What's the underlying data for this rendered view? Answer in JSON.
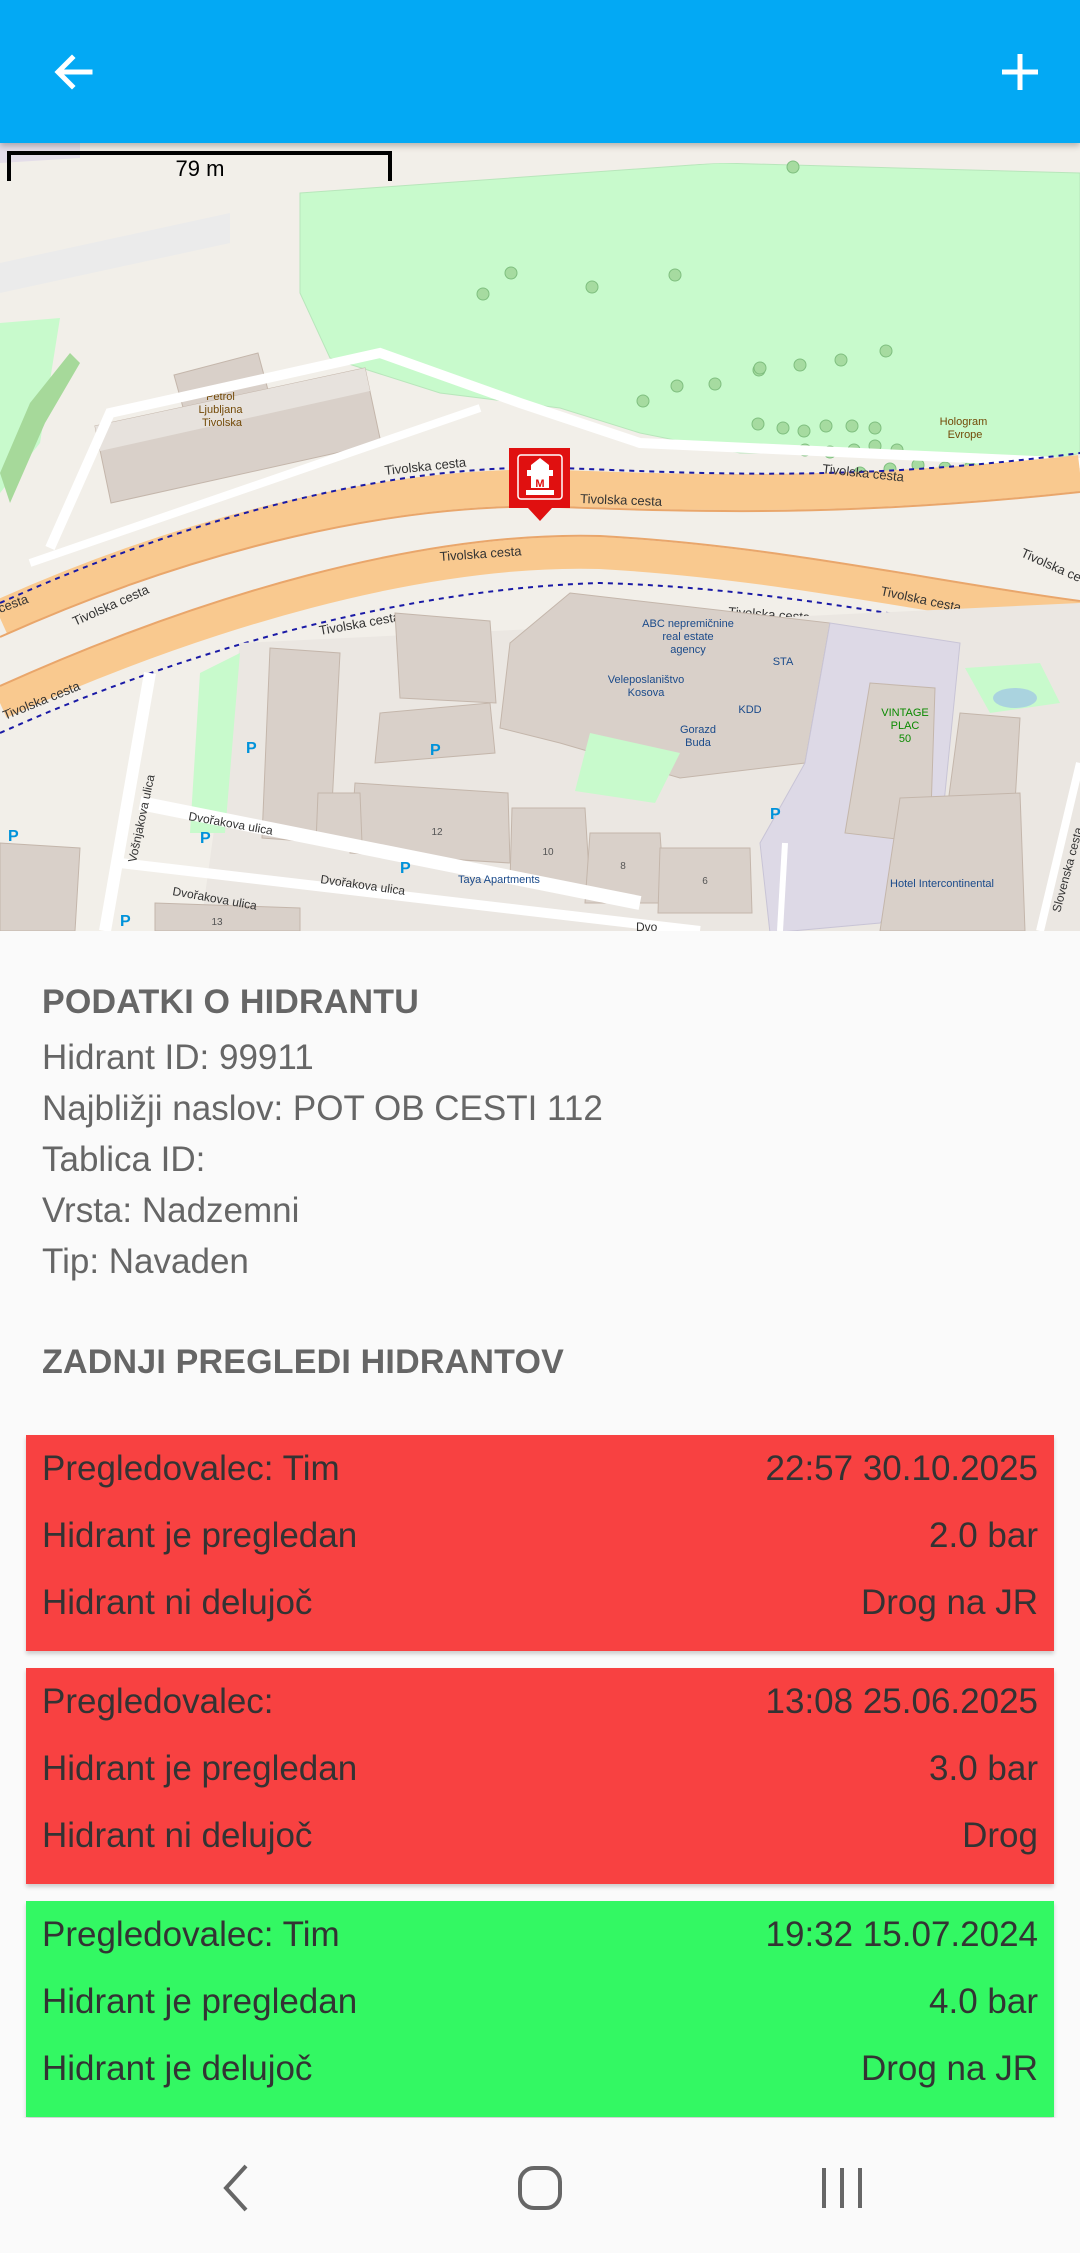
{
  "appbar": {
    "back_icon": "arrow-left-icon",
    "add_icon": "plus-icon",
    "background": "#03a9f4"
  },
  "map": {
    "scale_label": "79 m",
    "marker_icon": "hydrant-marker-icon",
    "labels": {
      "tivolska_1": "Tivolska cesta",
      "tivolska_2": "Tivolska cesta",
      "tivolska_3": "Tivolska cesta",
      "tivolska_4": "Tivolska cesta",
      "tivolska_5": "Tivolska cesta",
      "tivolska_6": "Tivolska cesta",
      "tivolska_7": "Tivolska cesta",
      "tivolska_8": "Tivolska cesta",
      "tivolska_9": "Tivolska cesta",
      "tivolska_10": "Tivolska cesta",
      "cesta_edge": "cesta",
      "petrol_1": "Petrol",
      "petrol_2": "Ljubljana",
      "petrol_3": "Tivolska",
      "hologram_1": "Hologram",
      "hologram_2": "Evrope",
      "abc_1": "ABC nepremičnine",
      "abc_2": "real estate",
      "abc_3": "agency",
      "sta": "STA",
      "kdd": "KDD",
      "veleposlanistvo_1": "Veleposlaništvo",
      "veleposlanistvo_2": "Kosova",
      "gorazd_1": "Gorazd",
      "gorazd_2": "Buda",
      "vintage_1": "VINTAGE",
      "vintage_2": "PLAC",
      "vintage_3": "50",
      "dvorakova_1": "Dvořakova ulica",
      "dvorakova_2": "Dvořakova ulica",
      "dvorakova_3": "Dvořakova ulica",
      "vosnjakova": "Vošnjakova ulica",
      "taya": "Taya Apartments",
      "hotel": "Hotel Intercontinental",
      "slovenska": "Slovenska cesta",
      "n12": "12",
      "n10": "10",
      "n8": "8",
      "n6": "6",
      "n13": "13",
      "dvo_cut": "Dvo"
    }
  },
  "info": {
    "title": "PODATKI O HIDRANTU",
    "hydrant_id": "Hidrant ID: 99911",
    "address": "Najbližji naslov: POT OB CESTI 112",
    "plate_id": "Tablica ID:",
    "kind": "Vrsta: Nadzemni",
    "type": "Tip: Navaden"
  },
  "inspections": {
    "title": "ZADNJI PREGLEDI HIDRANTOV",
    "items": [
      {
        "status_color": "#f84141",
        "inspector": "Pregledovalec: Tim",
        "datetime": "22:57 30.10.2025",
        "inspected": "Hidrant je pregledan",
        "pressure": "2.0 bar",
        "working": "Hidrant ni delujoč",
        "note": "Drog na JR"
      },
      {
        "status_color": "#f84141",
        "inspector": "Pregledovalec:",
        "datetime": "13:08 25.06.2025",
        "inspected": "Hidrant je pregledan",
        "pressure": "3.0 bar",
        "working": "Hidrant ni delujoč",
        "note": "Drog"
      },
      {
        "status_color": "#33f863",
        "inspector": "Pregledovalec: Tim",
        "datetime": "19:32 15.07.2024",
        "inspected": "Hidrant je pregledan",
        "pressure": "4.0 bar",
        "working": "Hidrant je delujoč",
        "note": "Drog na JR"
      }
    ]
  },
  "navbar": {
    "back_icon": "nav-back-icon",
    "home_icon": "nav-home-icon",
    "recents_icon": "nav-recents-icon"
  }
}
